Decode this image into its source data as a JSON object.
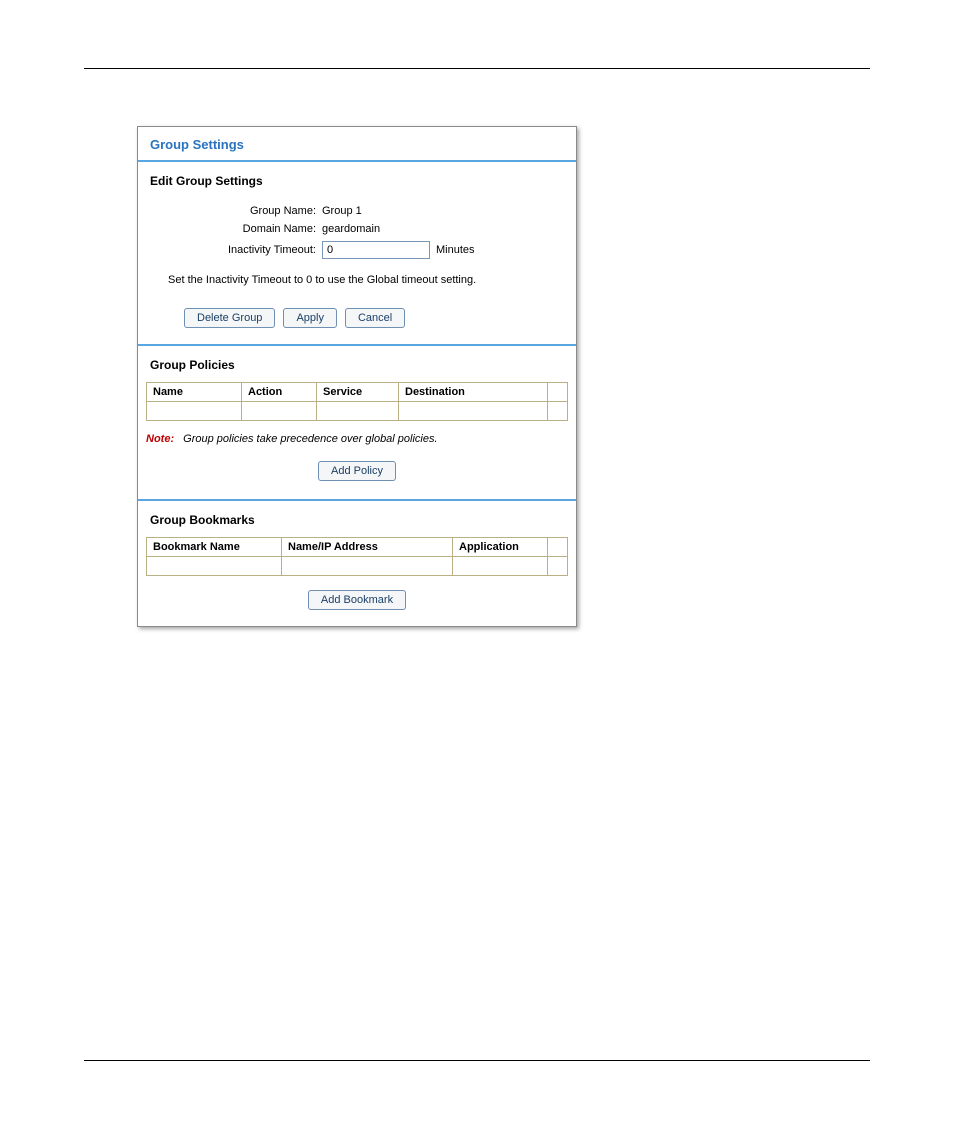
{
  "panel": {
    "title": "Group Settings"
  },
  "edit": {
    "section_title": "Edit Group Settings",
    "group_name_label": "Group Name:",
    "group_name_value": "Group 1",
    "domain_name_label": "Domain Name:",
    "domain_name_value": "geardomain",
    "inactivity_label": "Inactivity Timeout:",
    "inactivity_value": "0",
    "inactivity_unit": "Minutes",
    "help_text": "Set the Inactivity Timeout to 0 to use the Global timeout setting.",
    "buttons": {
      "delete": "Delete Group",
      "apply": "Apply",
      "cancel": "Cancel"
    }
  },
  "policies": {
    "section_title": "Group Policies",
    "headers": {
      "name": "Name",
      "action": "Action",
      "service": "Service",
      "destination": "Destination"
    },
    "note_label": "Note:",
    "note_text": "Group policies take precedence over global policies.",
    "add_button": "Add Policy"
  },
  "bookmarks": {
    "section_title": "Group Bookmarks",
    "headers": {
      "bookmark_name": "Bookmark Name",
      "name_ip": "Name/IP Address",
      "application": "Application"
    },
    "add_button": "Add Bookmark"
  }
}
